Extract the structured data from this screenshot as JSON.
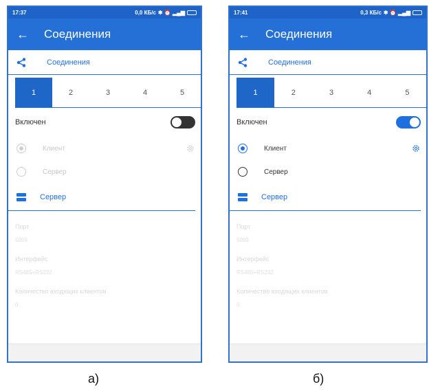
{
  "panel_a": {
    "status": {
      "time": "17:37",
      "info": "0,0 КБ/с",
      "net": "3G ₄ₗ4G",
      "battery": ""
    },
    "title": "Соединения",
    "section_label": "Соединения",
    "tabs": [
      "1",
      "2",
      "3",
      "4",
      "5"
    ],
    "toggle_label": "Включен",
    "toggle_state": "off",
    "radio_client": "Клиент",
    "radio_server": "Сервер",
    "server_section": "Сервер",
    "port_label": "Порт",
    "port_value": "5009",
    "interface_label": "Интерфейс",
    "interface_value": "RS485+RS232",
    "clients_label": "Количество входящих клиентов",
    "clients_value": "0",
    "caption": "а)"
  },
  "panel_b": {
    "status": {
      "time": "17:41",
      "info": "0,3 КБ/с",
      "net": "3G ₄ₗ4G",
      "battery": ""
    },
    "title": "Соединения",
    "section_label": "Соединения",
    "tabs": [
      "1",
      "2",
      "3",
      "4",
      "5"
    ],
    "toggle_label": "Включен",
    "toggle_state": "on",
    "radio_client": "Клиент",
    "radio_server": "Сервер",
    "server_section": "Сервер",
    "port_label": "Порт",
    "port_value": "5009",
    "interface_label": "Интерфейс",
    "interface_value": "RS485+RS232",
    "clients_label": "Количество входящих клиентов",
    "clients_value": "0",
    "caption": "б)"
  },
  "colors": {
    "primary": "#2470d6",
    "status_bar": "#1e64c8",
    "active_tab": "#1f66c9",
    "switch_on": "#1e6fe0"
  },
  "icons": {
    "back": "arrow-left-icon",
    "share": "share-icon",
    "server": "server-icon",
    "settings": "gear-icon"
  }
}
